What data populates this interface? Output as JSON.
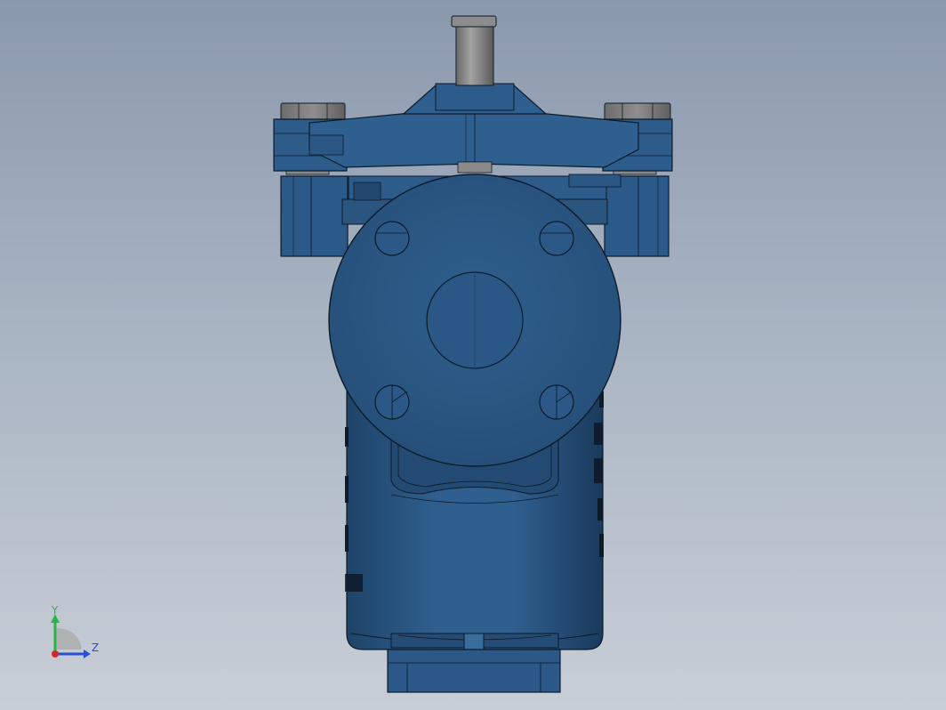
{
  "colors": {
    "background_top": "#8b99ad",
    "background_bottom": "#c8ced7",
    "body_blue": "#2d5a86",
    "body_blue_dark": "#1d3f63",
    "body_blue_light": "#3a6c9c",
    "steel_gray": "#7a7a7a",
    "steel_gray_light": "#9a9a9a",
    "outline": "#0d1a28",
    "axis_y": "#2db34a",
    "axis_z": "#2850d0",
    "axis_x": "#d02828"
  },
  "triad": {
    "y_label": "Y",
    "z_label": "Z"
  },
  "model": {
    "description_icon": "valve-strainer-model"
  }
}
